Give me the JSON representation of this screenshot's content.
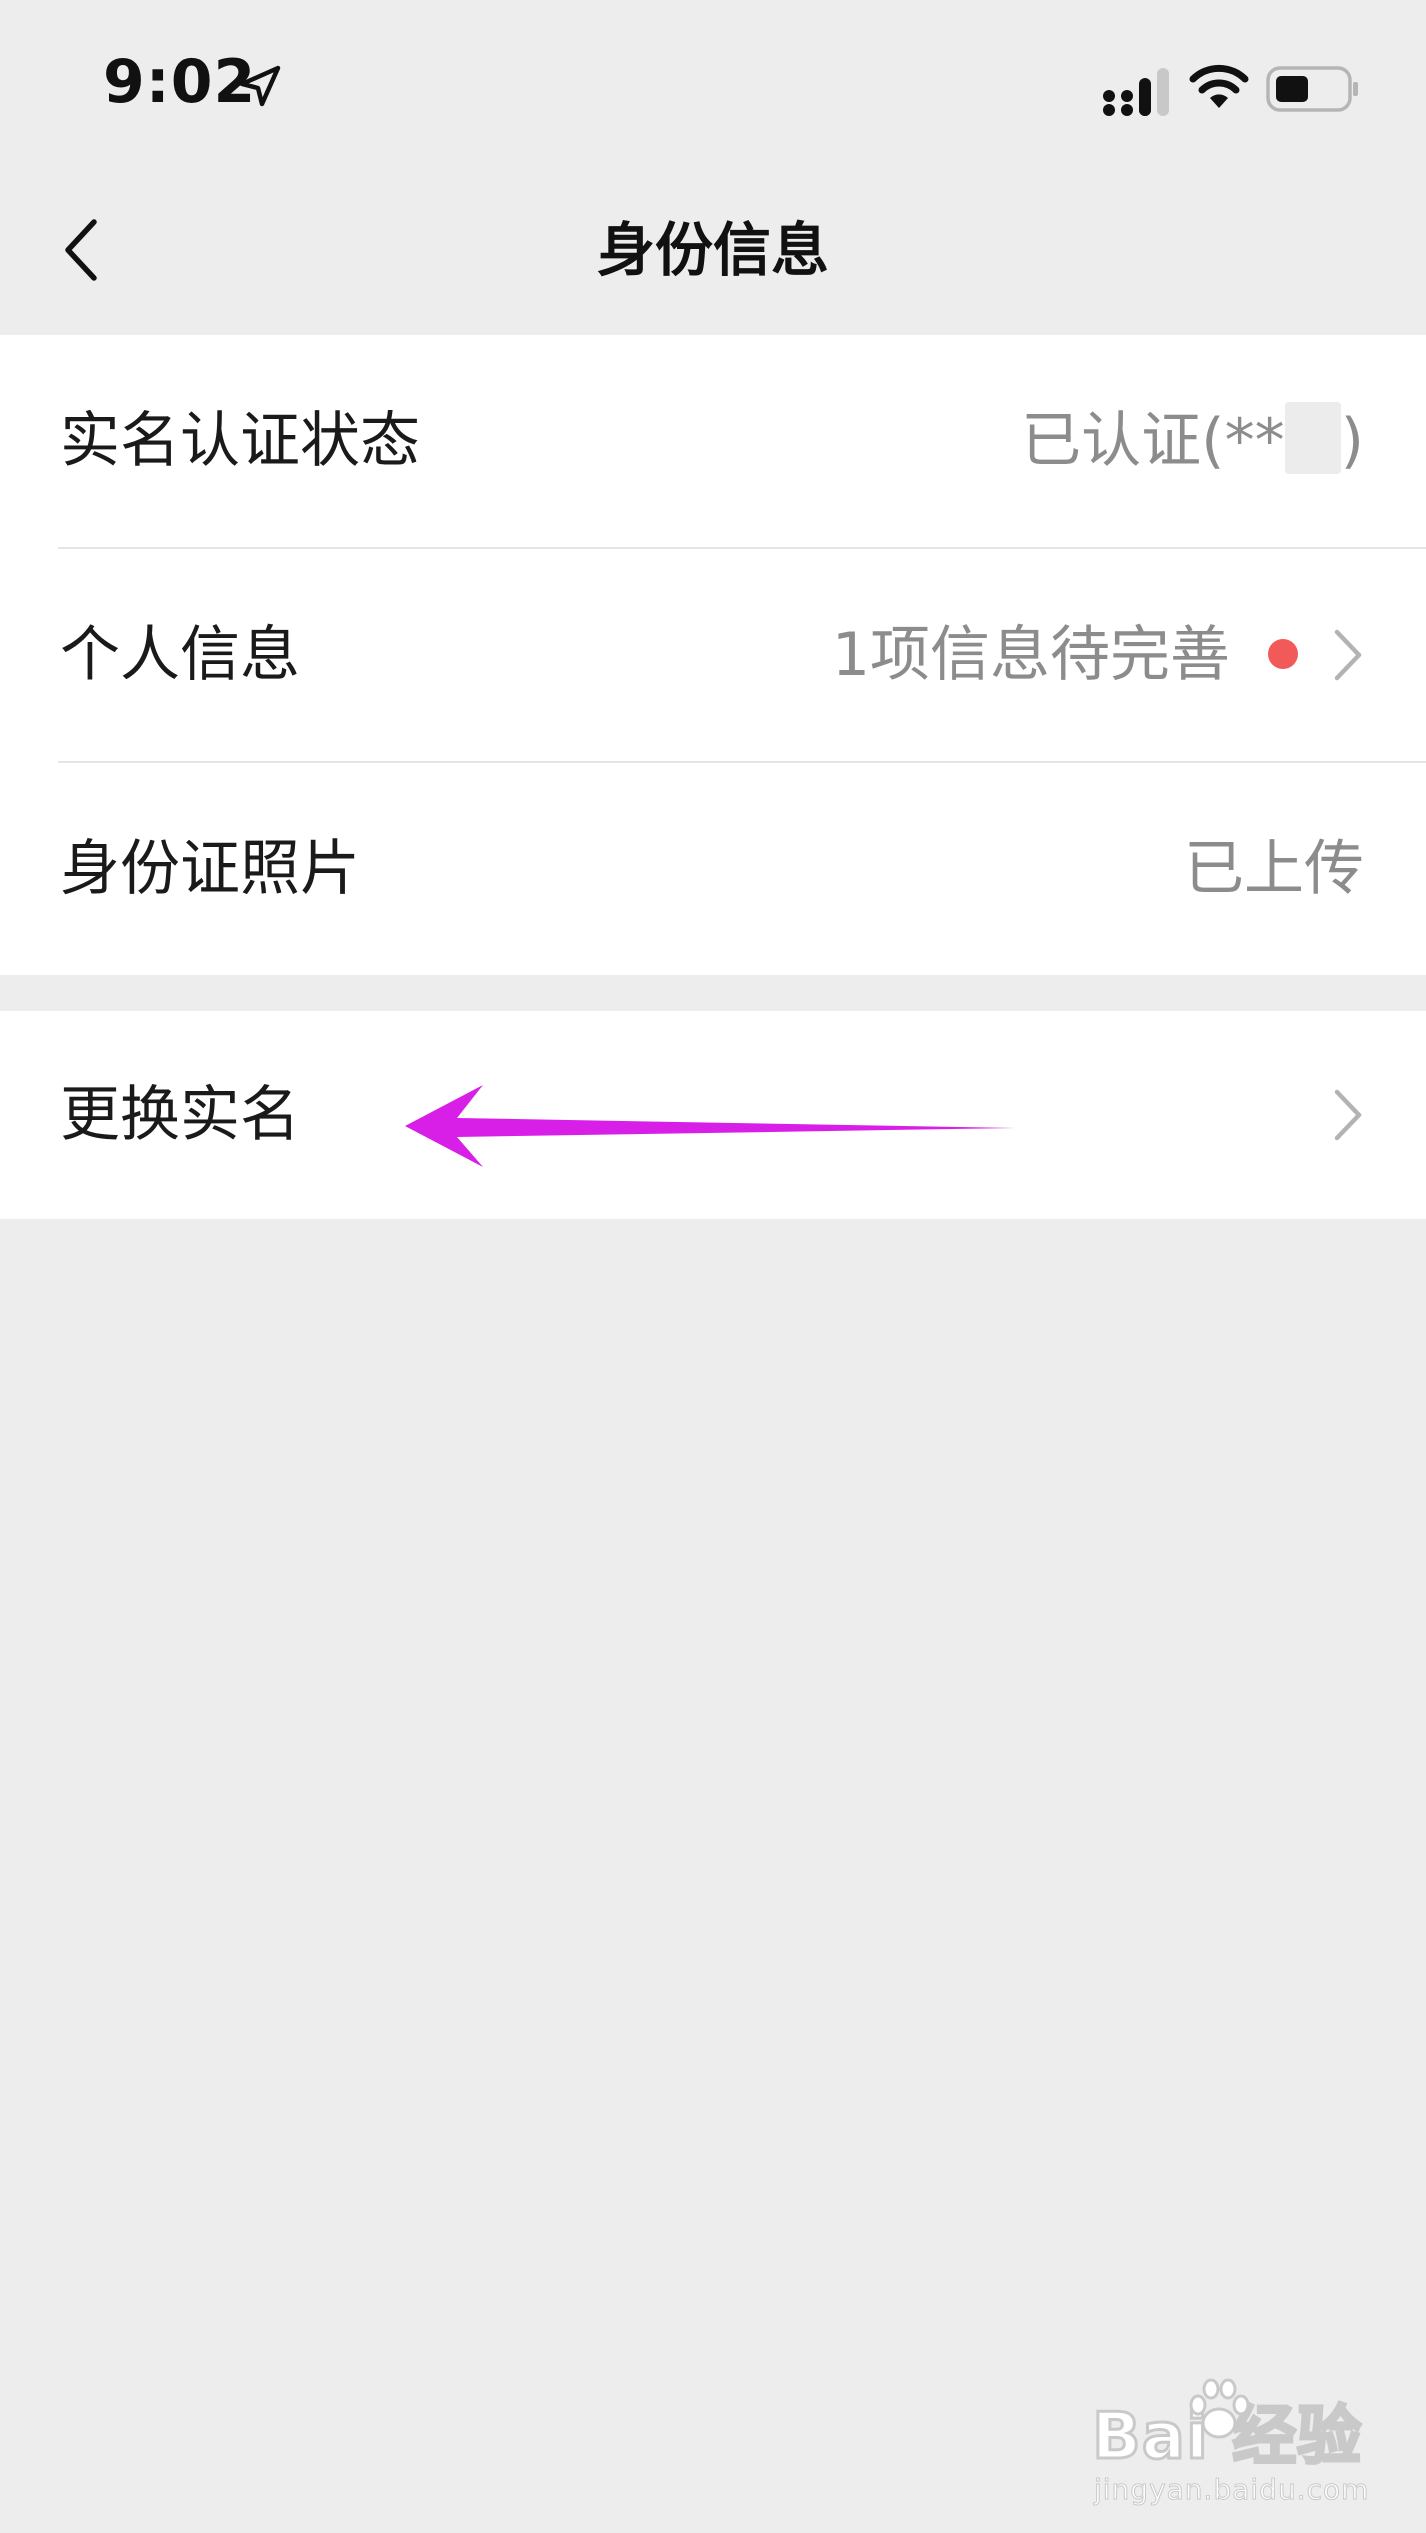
{
  "status_bar": {
    "time": "9:02",
    "icons": [
      "location-arrow-icon",
      "signal-icon",
      "wifi-icon",
      "battery-icon"
    ]
  },
  "nav": {
    "title": "身份信息",
    "back_icon": "chevron-left-icon"
  },
  "groups": [
    {
      "cells": [
        {
          "label": "实名认证状态",
          "value": "已认证(**",
          "value_suffix": ")"
        },
        {
          "label": "个人信息",
          "value": "1项信息待完善",
          "has_red_dot": true,
          "has_arrow": true
        },
        {
          "label": "身份证照片",
          "value": "已上传"
        }
      ]
    },
    {
      "cells": [
        {
          "label": "更换实名",
          "has_arrow": true
        }
      ]
    }
  ],
  "colors": {
    "background": "#ededed",
    "cell_background": "#ffffff",
    "value_text": "#8c8c8c",
    "red_dot": "#f25a5a",
    "annotation_arrow": "#d81fe8"
  },
  "watermark": {
    "brand": "Bai  经验",
    "url": "jingyan.baidu.com"
  }
}
